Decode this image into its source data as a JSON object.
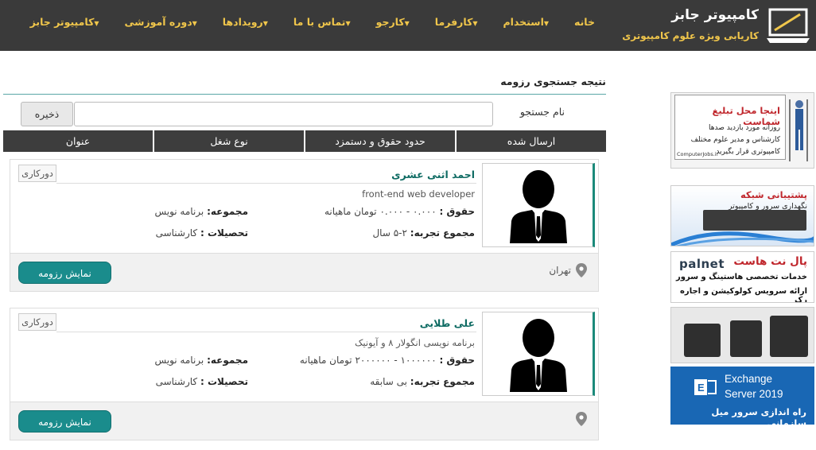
{
  "header": {
    "logo_title": "کامپیوتر جابز",
    "logo_subtitle": "کاریابی ویژه علوم کامپیوتری",
    "nav": [
      "خانه",
      "استخدام",
      "کارفرما",
      "کارجو",
      "تماس با ما",
      "رویدادها",
      "دوره آموزشی",
      "کامپیوتر جابز"
    ]
  },
  "page": {
    "title": "نتیجه جستجوی رزومه",
    "search_label": "نام جستجو",
    "search_value": "",
    "save_label": "ذخیره",
    "columns": [
      "ارسال شده",
      "حدود حقوق و دستمزد",
      "نوع شغل",
      "عنوان"
    ]
  },
  "labels": {
    "salary": "حقوق :",
    "experience": "مجموع تجربه:",
    "category": "مجموعه:",
    "education": "تحصیلات :",
    "show_resume": "نمایش رزومه"
  },
  "resumes": [
    {
      "name": "احمد اثنی عشری",
      "job_title": "front-end web developer",
      "badge": "دورکاری",
      "salary": "۰.۰۰۰ - ۰.۰۰۰ تومان ماهیانه",
      "experience": "۲-۵ سال",
      "category": "برنامه نویس",
      "education": "کارشناسی",
      "location": "تهران"
    },
    {
      "name": "علی طلایی",
      "job_title": "برنامه نویسی انگولار ۸ و آیونیک",
      "badge": "دورکاری",
      "salary": "۱۰۰۰۰۰۰ - ۲۰۰۰۰۰۰ تومان ماهیانه",
      "experience": "بی سابقه",
      "category": "برنامه نویس",
      "education": "کارشناسی",
      "location": ""
    }
  ],
  "ads": {
    "ad1_title": "اینجا محل تبلیغ شماست",
    "ad1_text": "روزانه مورد بازدید صدها کارشناس و مدیر علوم مختلف کامپیوتری قرار بگیرید",
    "ad1_footer": "ComputerJobs.ir",
    "ad2_title": "پشتیبانی شبکه",
    "ad2_text": "نگهداری سرور و کامپیوتر",
    "ad3_logo": "palnet",
    "ad3_title": "پال نت هاست",
    "ad3_line1": "خدمات تخصصی هاستینگ و سرور",
    "ad3_line2": "ارائه سرویس کولوکیشن و اجاره رک",
    "ad5_line1": "Exchange",
    "ad5_line2": "Server 2019",
    "ad5_line3": "راه اندازی سرور میل سازمانی"
  },
  "colors": {
    "header_bg": "#3a3a3a",
    "nav_text": "#f0c64b",
    "accent_teal": "#1a8c8c",
    "name_color": "#0e6b63"
  }
}
